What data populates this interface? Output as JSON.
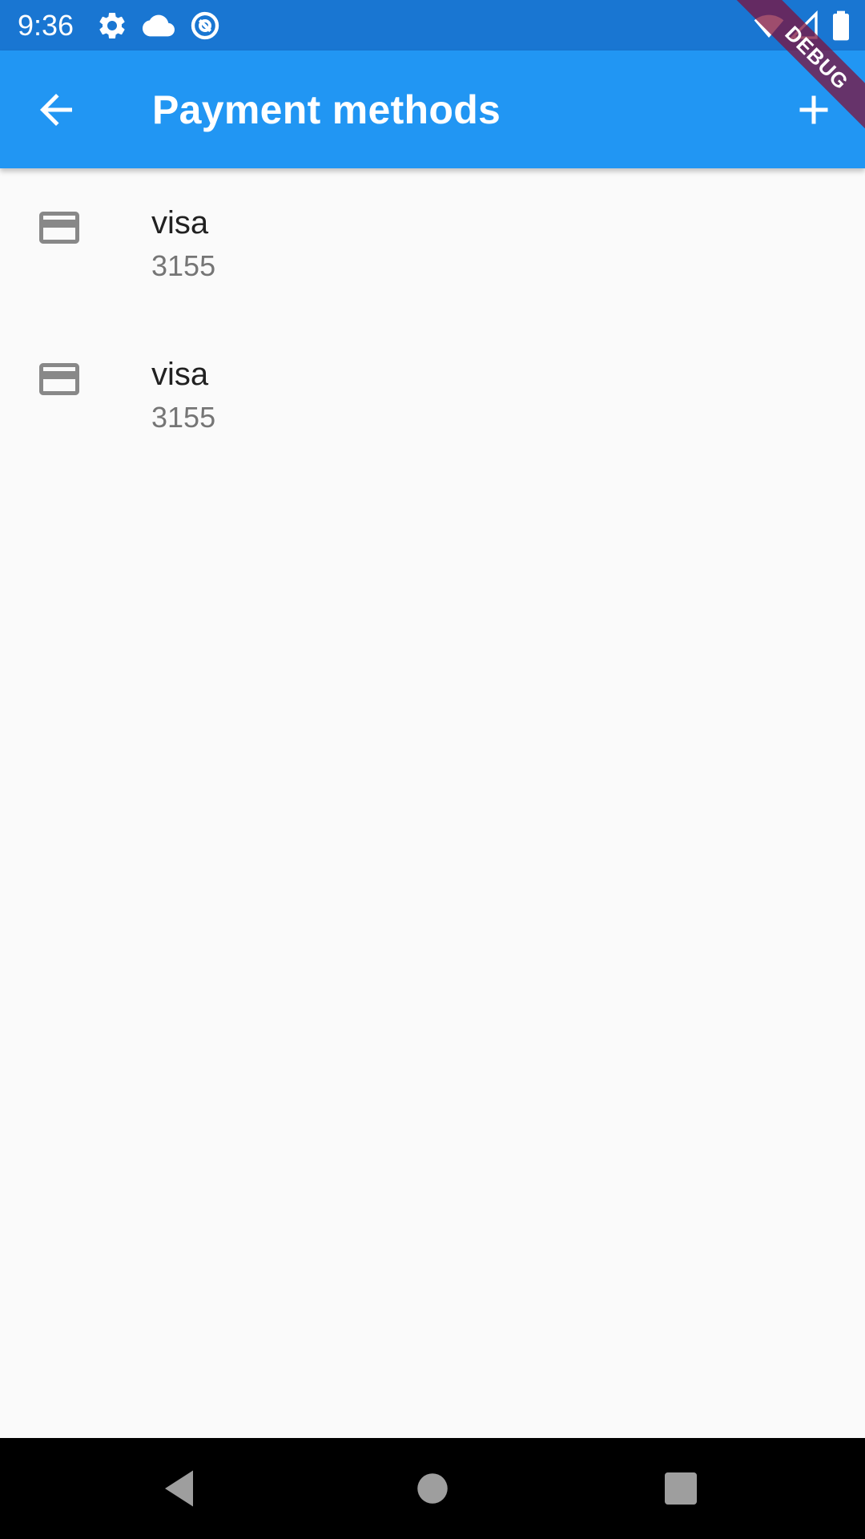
{
  "status_bar": {
    "time": "9:36",
    "left_icons": [
      "settings-icon",
      "cloud-icon",
      "at-sign-icon"
    ],
    "right_icons": [
      "wifi-icon",
      "signal-icon",
      "battery-icon"
    ]
  },
  "app_bar": {
    "title": "Payment methods",
    "back_icon": "arrow-back-icon",
    "action_icon": "add-icon",
    "color": "#2196F3",
    "status_color": "#1976D2"
  },
  "debug_banner": {
    "label": "DEBUG"
  },
  "payment_methods": [
    {
      "brand": "visa",
      "last4": "3155",
      "icon": "credit-card-icon"
    },
    {
      "brand": "visa",
      "last4": "3155",
      "icon": "credit-card-icon"
    }
  ],
  "nav_bar": {
    "buttons": [
      "back-triangle-icon",
      "home-circle-icon",
      "recents-square-icon"
    ]
  }
}
